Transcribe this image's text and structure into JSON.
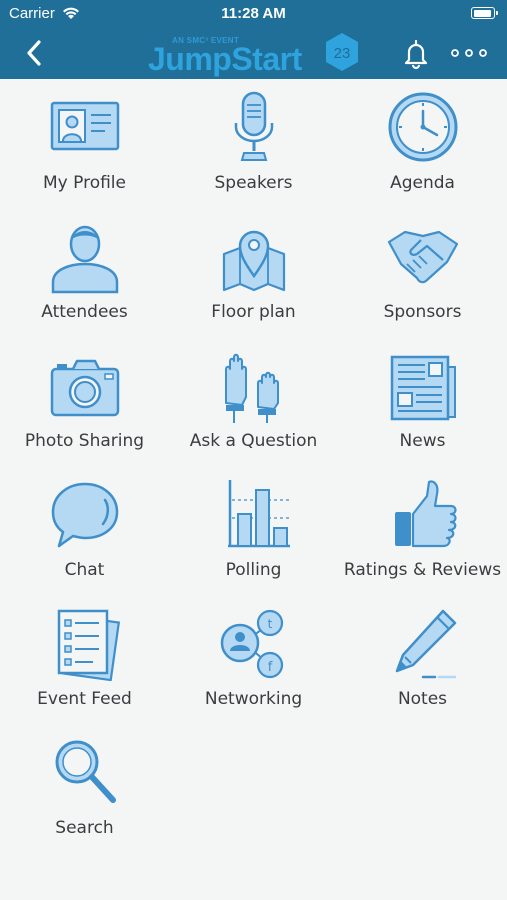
{
  "status_bar": {
    "carrier": "Carrier",
    "time": "11:28 AM"
  },
  "header": {
    "logo_tagline": "AN SMC³ EVENT",
    "logo_name": "JumpStart",
    "logo_badge": "23",
    "back_icon": "chevron-left-icon",
    "bell_icon": "bell-icon",
    "more_icon": "more-dots-icon"
  },
  "colors": {
    "header_bg": "#1f6f98",
    "icon_fill": "#b5d8f3",
    "icon_stroke": "#3f8fcb",
    "label": "#3a3d40",
    "background": "#f4f5f5"
  },
  "menu": [
    {
      "label": "My Profile",
      "icon": "profile-card-icon"
    },
    {
      "label": "Speakers",
      "icon": "microphone-icon"
    },
    {
      "label": "Agenda",
      "icon": "clock-icon"
    },
    {
      "label": "Attendees",
      "icon": "person-icon"
    },
    {
      "label": "Floor plan",
      "icon": "map-pin-icon"
    },
    {
      "label": "Sponsors",
      "icon": "handshake-icon"
    },
    {
      "label": "Photo Sharing",
      "icon": "camera-icon"
    },
    {
      "label": "Ask a Question",
      "icon": "raised-hands-icon"
    },
    {
      "label": "News",
      "icon": "newspaper-icon"
    },
    {
      "label": "Chat",
      "icon": "speech-bubble-icon"
    },
    {
      "label": "Polling",
      "icon": "bar-chart-icon"
    },
    {
      "label": "Ratings & Reviews",
      "icon": "thumbs-up-icon"
    },
    {
      "label": "Event Feed",
      "icon": "checklist-icon"
    },
    {
      "label": "Networking",
      "icon": "social-network-icon"
    },
    {
      "label": "Notes",
      "icon": "pen-icon"
    },
    {
      "label": "Search",
      "icon": "magnifier-icon"
    }
  ]
}
